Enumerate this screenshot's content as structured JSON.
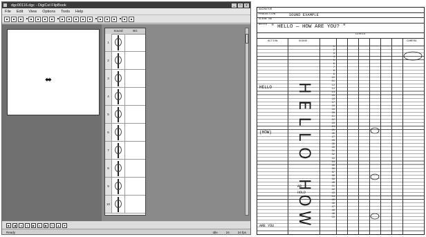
{
  "app": {
    "title": "dgc00116.dgc - DigiCel FlipBook",
    "window_buttons": [
      "_",
      "□",
      "x"
    ],
    "menu": [
      "File",
      "Edit",
      "View",
      "Options",
      "Tools",
      "Help"
    ],
    "xsheet_headers": [
      "",
      "Sound",
      "BG"
    ],
    "frame_numbers": [
      "1",
      "2",
      "3",
      "4",
      "5",
      "6",
      "7",
      "8",
      "9",
      "10"
    ],
    "status": {
      "left": "Ready",
      "idle": "Idle",
      "frame": "24",
      "fps": "24 fps"
    }
  },
  "sheet": {
    "animator_label": "ANIMATOR",
    "production_label": "PRODUCTION",
    "production_value": "SOUND   EXAMPLE",
    "scene_label": "SCENE NO",
    "notes_label": "NOTES",
    "notes_value": "\" HELLO  —  HOW   ARE   YOU? \"",
    "col_action": "ACTION",
    "col_sound": "SOUND",
    "col_camera": "CAMERA",
    "col_levels": "LEVELS",
    "action_hello": "HELLO",
    "action_how": "(HOW)",
    "action_are_you": "ARE YOU",
    "sound_letters": "HELLO",
    "sound_how": "HOW",
    "sound_ar": "AR",
    "sound_hold": "HOLD",
    "frames": [
      "1",
      "2",
      "3",
      "4",
      "5",
      "6",
      "7",
      "8",
      "9",
      "10",
      "11",
      "12",
      "13",
      "14",
      "15",
      "16",
      "17",
      "18",
      "19",
      "20",
      "21",
      "22",
      "23",
      "24",
      "25",
      "26",
      "27",
      "28",
      "29",
      "30",
      "31",
      "32",
      "33",
      "34",
      "35",
      "36",
      "37",
      "38",
      "39",
      "40",
      "41",
      "42",
      "43",
      "44",
      "45",
      "46",
      "47",
      "48",
      "49",
      "50"
    ]
  }
}
